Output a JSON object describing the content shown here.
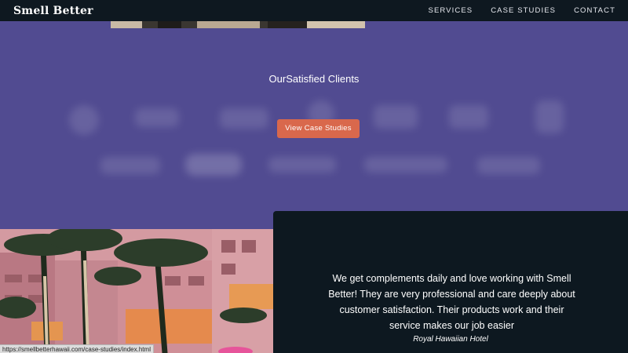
{
  "nav": {
    "brand": "Smell Better",
    "links": [
      "SERVICES",
      "CASE STUDIES",
      "CONTACT"
    ]
  },
  "clients": {
    "title": "OurSatisfied Clients",
    "cta_label": "View Case Studies"
  },
  "testimonial": {
    "quote": "We get complements daily and love working with Smell Better! They are very professional and care deeply about customer satisfaction. Their products work and their service makes our job easier",
    "client": "Royal Hawaiian Hotel"
  },
  "status_bar": {
    "url": "https://smellbetterhawaii.com/case-studies/index.html"
  },
  "colors": {
    "background": "#514b91",
    "nav": "#0e1820",
    "cta": "#d9684c",
    "testimonial_panel": "#0d1820"
  }
}
